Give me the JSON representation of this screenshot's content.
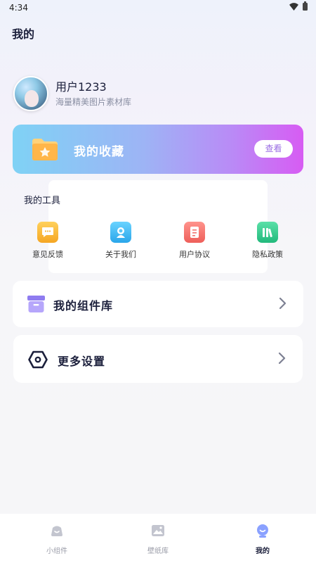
{
  "status_bar": {
    "time": "4:34"
  },
  "page": {
    "title": "我的"
  },
  "profile": {
    "username": "用户1233",
    "subtitle": "海量精美图片素材库"
  },
  "favorites": {
    "title": "我的收藏",
    "view_label": "查看"
  },
  "tools": {
    "title": "我的工具",
    "items": [
      {
        "label": "意见反馈",
        "icon": "feedback-icon",
        "color": "#f5b53d"
      },
      {
        "label": "关于我们",
        "icon": "about-icon",
        "color": "#3fb8ef"
      },
      {
        "label": "用户协议",
        "icon": "agreement-icon",
        "color": "#f27470"
      },
      {
        "label": "隐私政策",
        "icon": "privacy-icon",
        "color": "#34c98e"
      }
    ]
  },
  "menu": {
    "widget_library": "我的组件库",
    "more_settings": "更多设置"
  },
  "tabbar": {
    "items": [
      {
        "label": "小组件",
        "icon": "widget-icon",
        "active": false
      },
      {
        "label": "壁纸库",
        "icon": "wallpaper-icon",
        "active": false
      },
      {
        "label": "我的",
        "icon": "profile-icon",
        "active": true
      }
    ]
  },
  "colors": {
    "accent": "#9a6de3",
    "active_tab": "#8aa1ff",
    "text_dark": "#1b1f3b"
  }
}
